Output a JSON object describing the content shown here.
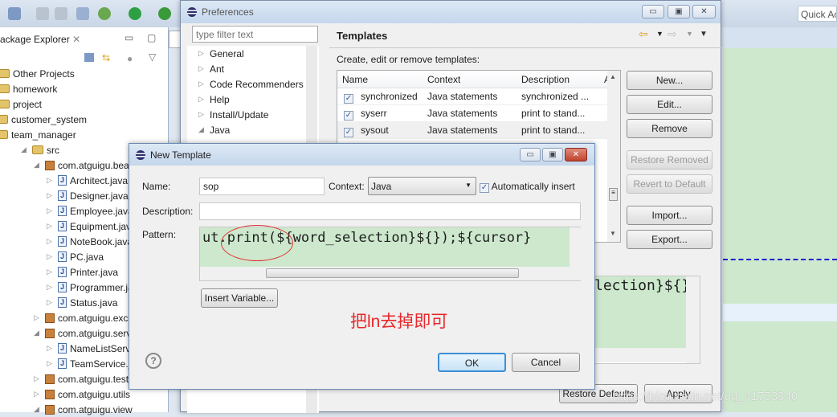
{
  "toolbar": {
    "quick_access": "Quick Ac"
  },
  "package_explorer": {
    "title": "ackage Explorer",
    "items": [
      {
        "label": "Other Projects",
        "indent": 0,
        "icon": "working-set"
      },
      {
        "label": "homework",
        "indent": 0,
        "icon": "working-set"
      },
      {
        "label": "project",
        "indent": 0,
        "icon": "working-set"
      },
      {
        "label": "customer_system",
        "indent": 1,
        "icon": "project-folder"
      },
      {
        "label": "team_manager",
        "indent": 1,
        "icon": "project-folder"
      },
      {
        "label": "src",
        "indent": 2,
        "icon": "source-folder"
      },
      {
        "label": "com.atguigu.bean",
        "indent": 3,
        "icon": "package"
      },
      {
        "label": "Architect.java",
        "indent": 4,
        "icon": "java-file"
      },
      {
        "label": "Designer.java",
        "indent": 4,
        "icon": "java-file"
      },
      {
        "label": "Employee.java",
        "indent": 4,
        "icon": "java-file"
      },
      {
        "label": "Equipment.java",
        "indent": 4,
        "icon": "java-interface"
      },
      {
        "label": "NoteBook.java",
        "indent": 4,
        "icon": "java-file"
      },
      {
        "label": "PC.java",
        "indent": 4,
        "icon": "java-file"
      },
      {
        "label": "Printer.java",
        "indent": 4,
        "icon": "java-file"
      },
      {
        "label": "Programmer.java",
        "indent": 4,
        "icon": "java-file"
      },
      {
        "label": "Status.java",
        "indent": 4,
        "icon": "java-file"
      },
      {
        "label": "com.atguigu.exception",
        "indent": 3,
        "icon": "package"
      },
      {
        "label": "com.atguigu.service",
        "indent": 3,
        "icon": "package"
      },
      {
        "label": "NameListService.java",
        "indent": 4,
        "icon": "java-file"
      },
      {
        "label": "TeamService.java",
        "indent": 4,
        "icon": "java-file"
      },
      {
        "label": "com.atguigu.test",
        "indent": 3,
        "icon": "package"
      },
      {
        "label": "com.atguigu.utils",
        "indent": 3,
        "icon": "package"
      },
      {
        "label": "com.atguigu.view",
        "indent": 3,
        "icon": "package"
      }
    ]
  },
  "preferences": {
    "title": "Preferences",
    "filter_placeholder": "type filter text",
    "tree": [
      "General",
      "Ant",
      "Code Recommenders",
      "Help",
      "Install/Update",
      "Java"
    ],
    "page_title": "Templates",
    "description": "Create, edit or remove templates:",
    "columns": [
      "Name",
      "Context",
      "Description",
      "A"
    ],
    "rows": [
      {
        "name": "synchronized",
        "context": "Java statements",
        "description": "synchronized ...",
        "checked": true
      },
      {
        "name": "syserr",
        "context": "Java statements",
        "description": "print to stand...",
        "checked": true
      },
      {
        "name": "sysout",
        "context": "Java statements",
        "description": "print to stand...",
        "checked": true
      }
    ],
    "buttons": {
      "new": "New...",
      "edit": "Edit...",
      "remove": "Remove",
      "restore_removed": "Restore Removed",
      "revert": "Revert to Default",
      "import": "Import...",
      "export": "Export...",
      "restore_defaults": "Restore Defaults",
      "apply": "Apply"
    },
    "preview_text": "lection}${})"
  },
  "new_template": {
    "title": "New Template",
    "name_label": "Name:",
    "name_value": "sop",
    "context_label": "Context:",
    "context_value": "Java",
    "auto_insert_label": "Automatically insert",
    "auto_insert_checked": true,
    "description_label": "Description:",
    "description_value": "",
    "pattern_label": "Pattern:",
    "pattern_value": "ut.print(${word_selection}${});${cursor}",
    "insert_variable": "Insert Variable...",
    "annotation": "把ln去掉即可",
    "ok": "OK",
    "cancel": "Cancel"
  },
  "watermark": "https://blog.csdn.net/qq_41753340",
  "colors": {
    "annotation": "#e8282a",
    "pattern_bg": "#cde8cd",
    "ok_border": "#3c8fd6"
  }
}
